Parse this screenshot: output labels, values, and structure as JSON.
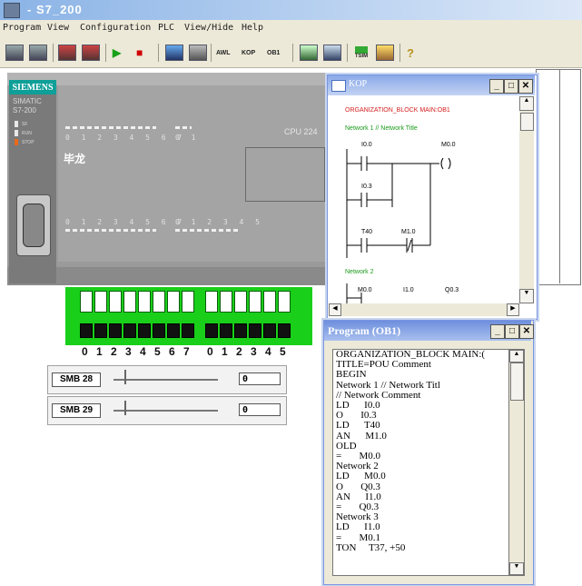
{
  "app": {
    "title": "- S7_200"
  },
  "menu": [
    "Program",
    "View",
    "Configuration",
    "PLC",
    "View/Hide",
    "Help"
  ],
  "toolbar": {
    "awl_label": "AWL",
    "kop_label": "KOP",
    "ob1_label": "OB1",
    "tsim_label": "TSIM"
  },
  "plc": {
    "brand": "SIEMENS",
    "model_line1": "SIMATIC",
    "model_line2": "S7-200",
    "status_leds": [
      "SF",
      "RUN",
      "STOP"
    ],
    "cpu_label": "CPU 224",
    "input_digits_a": "0 1 2 3 4 5 6 7",
    "input_digits_b": "0 1",
    "output_digits_a": "0 1 2 3 4 5 6 7",
    "output_digits_b": "0 1 2 3 4 5",
    "brand_chinese": "毕龙"
  },
  "switches": {
    "labels_a": [
      "0",
      "1",
      "2",
      "3",
      "4",
      "5",
      "6",
      "7"
    ],
    "labels_b": [
      "0",
      "1",
      "2",
      "3",
      "4",
      "5"
    ]
  },
  "sliders": [
    {
      "label": "SMB 28",
      "value": "0",
      "level": 0.1
    },
    {
      "label": "SMB 29",
      "value": "0",
      "level": 0.1
    }
  ],
  "kop_window": {
    "title": "KOP",
    "org_block": "ORGANIZATION_BLOCK MAIN:OB1",
    "network1": "Network 1 // Network Title",
    "contacts": [
      "I0.0",
      "M0.0",
      "I0.3",
      "T40",
      "M1.0"
    ],
    "network2": "Network 2",
    "row2": [
      "M0.0",
      "I1.0",
      "Q0.3"
    ],
    "colors": {
      "red": "#d42020",
      "green": "#1a9a1a"
    }
  },
  "program_window": {
    "title": "Program (OB1)",
    "lines": [
      "ORGANIZATION_BLOCK MAIN:(",
      "TITLE=POU Comment",
      "BEGIN",
      "Network 1 // Network Titl",
      "// Network Comment",
      "LD      I0.0",
      "O       I0.3",
      "LD      T40",
      "AN      M1.0",
      "OLD",
      "=       M0.0",
      "Network 2",
      "LD      M0.0",
      "O       Q0.3",
      "AN      I1.0",
      "=       Q0.3",
      "Network 3",
      "LD      I1.0",
      "=       M0.1",
      "TON     T37, +50"
    ]
  }
}
